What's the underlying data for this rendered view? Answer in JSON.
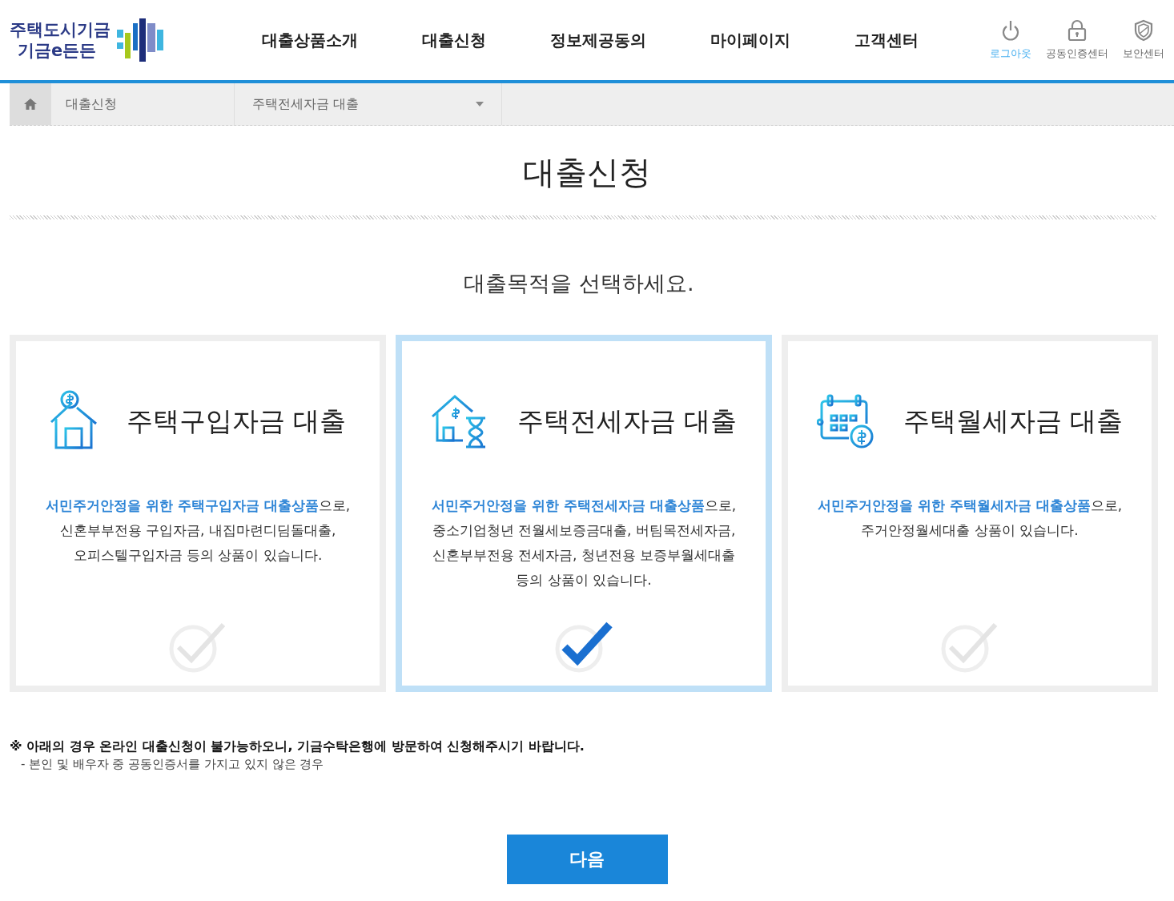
{
  "logo": {
    "line1": "주택도시기금",
    "line2": "기금e든든"
  },
  "nav": [
    {
      "label": "대출상품소개"
    },
    {
      "label": "대출신청"
    },
    {
      "label": "정보제공동의"
    },
    {
      "label": "마이페이지"
    },
    {
      "label": "고객센터"
    }
  ],
  "utility": [
    {
      "kind": "power",
      "label": "로그아웃",
      "active": true
    },
    {
      "kind": "lock",
      "label": "공동인증센터",
      "active": false
    },
    {
      "kind": "shield",
      "label": "보안센터",
      "active": false
    }
  ],
  "breadcrumb": {
    "section": "대출신청",
    "current": "주택전세자금 대출"
  },
  "title": "대출신청",
  "subtitle": "대출목적을 선택하세요.",
  "cards": [
    {
      "kind": "purchase",
      "title": "주택구입자금 대출",
      "selected": false,
      "lines": [
        "**서민주거안정을 위한 주택구입자금 대출상품**으로,",
        "신혼부부전용 구입자금, 내집마련디딤돌대출,",
        "오피스텔구입자금 등의 상품이 있습니다."
      ]
    },
    {
      "kind": "jeonse",
      "title": "주택전세자금 대출",
      "selected": true,
      "lines": [
        "**서민주거안정을 위한 주택전세자금 대출상품**으로,",
        "중소기업청년 전월세보증금대출, 버팀목전세자금,",
        "신혼부부전용 전세자금, 청년전용 보증부월세대출",
        "등의 상품이 있습니다."
      ]
    },
    {
      "kind": "monthly",
      "title": "주택월세자금 대출",
      "selected": false,
      "lines": [
        "**서민주거안정을 위한 주택월세자금 대출상품**으로,",
        "주거안정월세대출 상품이 있습니다."
      ]
    }
  ],
  "notice": {
    "heading": "※ 아래의 경우 온라인 대출신청이 불가능하오니, 기금수탁은행에 방문하여 신청해주시기 바랍니다.",
    "item": "- 본인 및 배우자 중 공동인증서를 가지고 있지 않은 경우"
  },
  "next_button": "다음"
}
